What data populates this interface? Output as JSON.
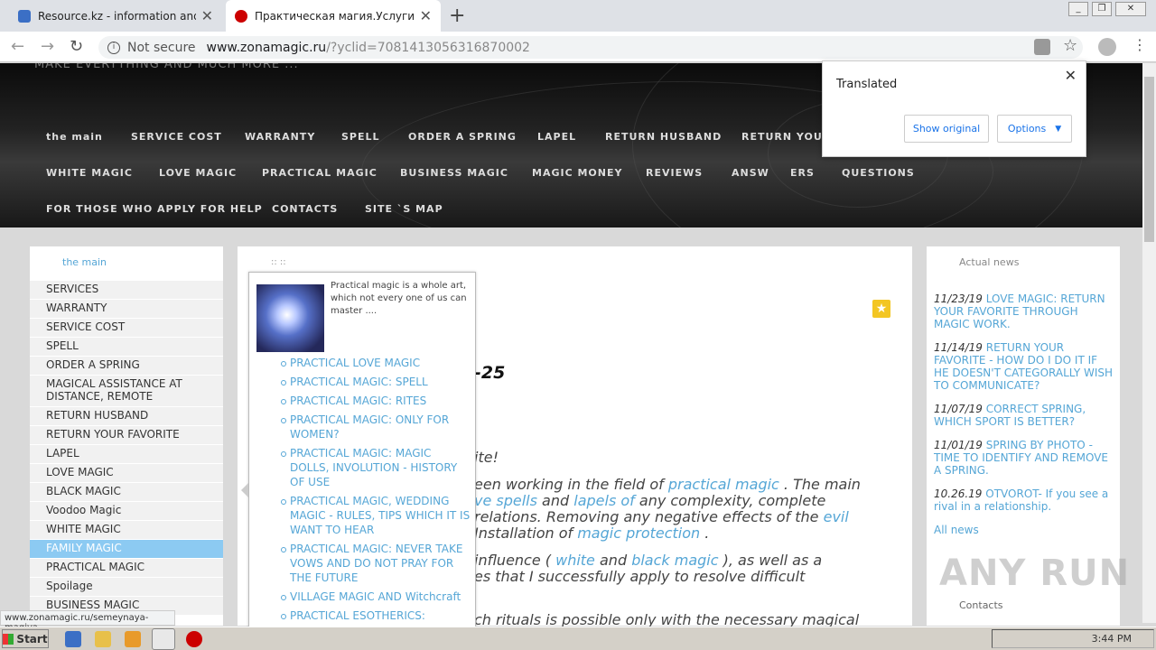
{
  "tabs": [
    {
      "title": "Resource.kz - information and enter",
      "icon": "ie-icon",
      "color": "#3b6fc5"
    },
    {
      "title": "Практическая магия.Услуги.",
      "icon": "site-icon",
      "color": "#cc0000"
    }
  ],
  "toolbar": {
    "security": "Not secure",
    "url": "www.zonamagic.ru",
    "query": "/?yclid=7081413056316870002"
  },
  "banner": {
    "tagline": "MAKE EVERYTHING AND MUCH MORE ..."
  },
  "menu": [
    "the main",
    "SERVICE COST",
    "WARRANTY",
    "SPELL",
    "ORDER A SPRING",
    "LAPEL",
    "RETURN HUSBAND",
    "RETURN YOUR",
    "WHITE MAGIC",
    "LOVE MAGIC",
    "PRACTICAL MAGIC",
    "BUSINESS MAGIC",
    "MAGIC MONEY",
    "REVIEWS",
    "ANSW",
    "ERS",
    "QUESTIONS",
    "FOR THOSE WHO APPLY FOR HELP",
    "CONTACTS",
    "SITE `S MAP"
  ],
  "sidebar": {
    "heading": "the main",
    "items": [
      "SERVICES",
      "WARRANTY",
      "SERVICE COST",
      "SPELL",
      "ORDER A SPRING",
      "MAGICAL ASSISTANCE AT DISTANCE, REMOTE",
      "RETURN HUSBAND",
      "RETURN YOUR FAVORITE",
      "LAPEL",
      "LOVE MAGIC",
      "BLACK MAGIC",
      "Voodoo Magic",
      "WHITE MAGIC",
      "FAMILY MAGIC",
      "PRACTICAL MAGIC",
      "Spoilage",
      "BUSINESS MAGIC"
    ]
  },
  "main": {
    "crumb": ":: ::",
    "date_frag": "-25",
    "l1": "ite!",
    "l2a": "een working in the field of ",
    "l2b": "practical magic",
    "l2c": " . The main",
    "l3a": "ve spells",
    "l3b": " and ",
    "l3c": "lapels of",
    "l3d": " any complexity, complete",
    "l4a": "relations. Removing any negative effects of the ",
    "l4b": "evil",
    "l5a": "Installation of ",
    "l5b": "magic protection",
    "l5c": " .",
    "l6a": "influence ( ",
    "l6b": "white",
    "l6c": " and ",
    "l6d": "black magic",
    "l6e": " ), as well as a",
    "l7": "es that I successfully apply to resolve difficult",
    "l8": "ch rituals is possible only with the necessary magical"
  },
  "dropdown": {
    "intro": "Practical magic is a whole art, which not every one of us can master ....",
    "items": [
      "PRACTICAL LOVE MAGIC",
      "PRACTICAL MAGIC: SPELL",
      "PRACTICAL MAGIC: RITES",
      "PRACTICAL MAGIC: ONLY FOR WOMEN?",
      "PRACTICAL MAGIC: MAGIC DOLLS, INVOLUTION - HISTORY OF USE",
      "PRACTICAL MAGIC, WEDDING MAGIC - RULES, TIPS WHICH IT IS WANT TO HEAR",
      "PRACTICAL MAGIC: NEVER TAKE VOWS AND DO NOT PRAY FOR THE FUTURE",
      "VILLAGE MAGIC AND Witchcraft",
      "PRACTICAL ESOTHERICS:"
    ]
  },
  "news": {
    "heading": "Actual news",
    "items": [
      {
        "date": "11/23/19",
        "text": "LOVE MAGIC: RETURN YOUR FAVORITE THROUGH MAGIC WORK."
      },
      {
        "date": "11/14/19",
        "text": "RETURN YOUR FAVORITE - HOW DO I DO IT IF HE DOESN'T CATEGORALLY WISH TO COMMUNICATE?"
      },
      {
        "date": "11/07/19",
        "text": "CORRECT SPRING, WHICH SPORT IS BETTER?"
      },
      {
        "date": "11/01/19",
        "text": "SPRING BY PHOTO - TIME TO IDENTIFY AND REMOVE A SPRING."
      },
      {
        "date": "10.26.19",
        "text": "OTVOROT- If you see a rival in a relationship."
      }
    ],
    "all": "All news",
    "contacts": "Contacts"
  },
  "translate": {
    "title": "Translated",
    "show_original": "Show original",
    "options": "Options"
  },
  "status_url": "www.zonamagic.ru/semeynaya-magiya",
  "taskbar": {
    "start": "Start",
    "time": "3:44 PM"
  },
  "watermark": "ANY RUN"
}
